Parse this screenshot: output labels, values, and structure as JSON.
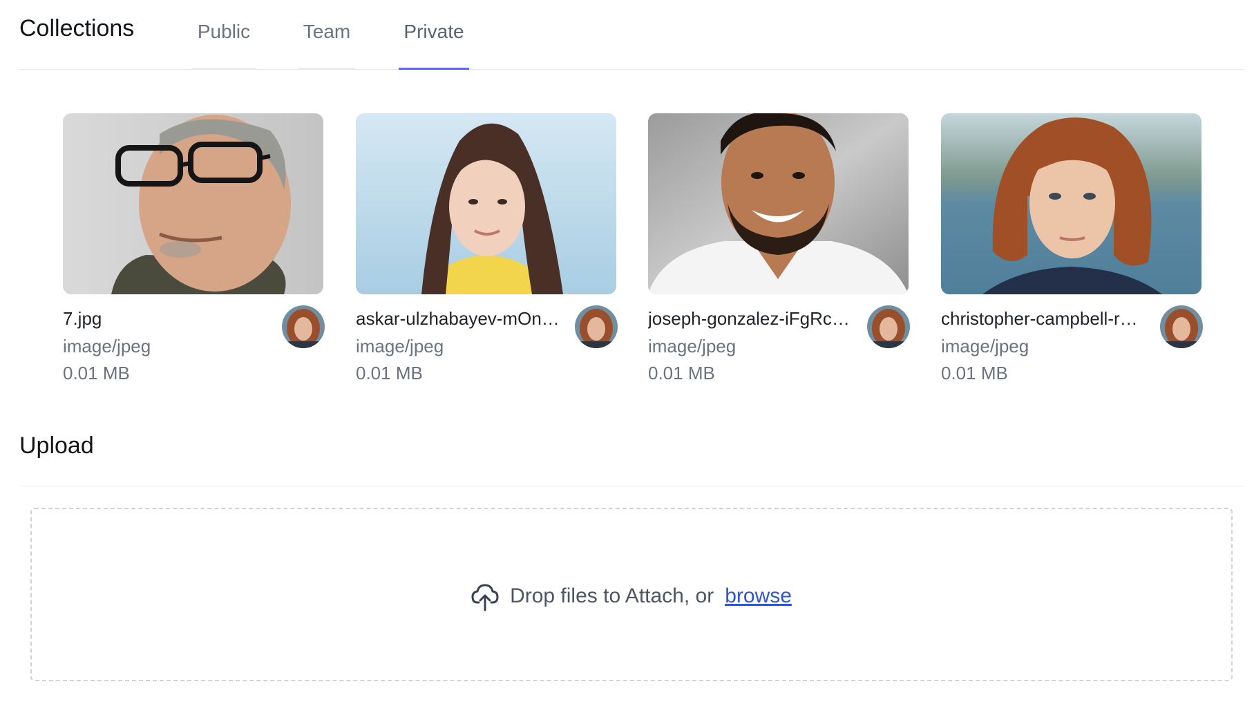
{
  "header": {
    "title": "Collections",
    "tabs": [
      {
        "label": "Public"
      },
      {
        "label": "Team"
      },
      {
        "label": "Private"
      }
    ],
    "active_tab": "Private"
  },
  "files": [
    {
      "name": "7.jpg",
      "type": "image/jpeg",
      "size": "0.01 MB"
    },
    {
      "name": "askar-ulzhabayev-mOn…",
      "type": "image/jpeg",
      "size": "0.01 MB"
    },
    {
      "name": "joseph-gonzalez-iFgRc…",
      "type": "image/jpeg",
      "size": "0.01 MB"
    },
    {
      "name": "christopher-campbell-r…",
      "type": "image/jpeg",
      "size": "0.01 MB"
    }
  ],
  "upload": {
    "title": "Upload",
    "prompt": "Drop files to Attach, or",
    "browse_label": "browse",
    "icon": "cloud-upload-icon"
  },
  "colors": {
    "accent": "#6366f1",
    "link": "#2f55d4",
    "border": "#e6e8eb"
  }
}
